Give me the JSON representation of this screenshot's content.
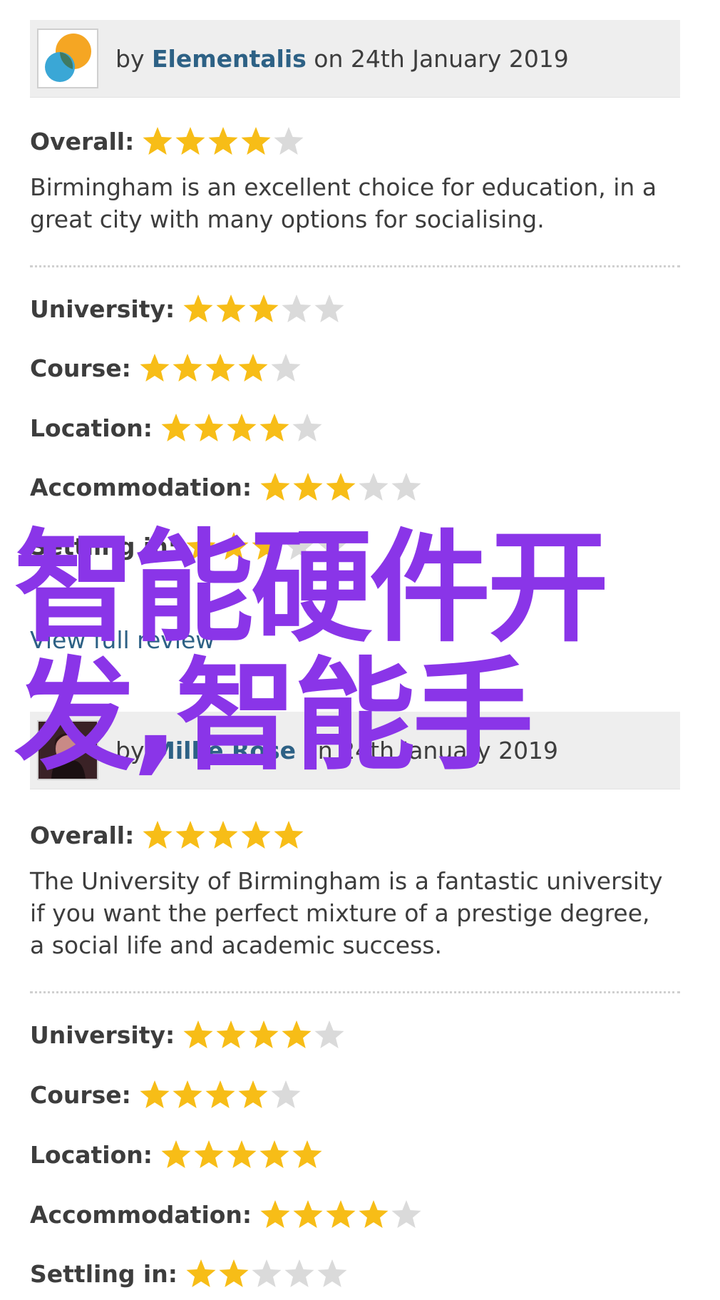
{
  "reviews": [
    {
      "by": "by",
      "author": "Elementalis",
      "on_date": "on 24th January 2019",
      "overall_label": "Overall:",
      "overall_rating": 4,
      "text": "Birmingham is an excellent choice for education, in a great city with many options for socialising.",
      "ratings": [
        {
          "label": "University:",
          "rating": 3
        },
        {
          "label": "Course:",
          "rating": 4
        },
        {
          "label": "Location:",
          "rating": 4
        },
        {
          "label": "Accommodation:",
          "rating": 3
        },
        {
          "label": "Settling in:",
          "rating": 3
        }
      ],
      "link": "View full review"
    },
    {
      "by": "by",
      "author": "Millie Rose",
      "on_date": "on 24th January 2019",
      "overall_label": "Overall:",
      "overall_rating": 5,
      "text": "The University of Birmingham is a fantastic university if you want the perfect mixture of a prestige degree, a social life and academic success.",
      "ratings": [
        {
          "label": "University:",
          "rating": 4
        },
        {
          "label": "Course:",
          "rating": 4
        },
        {
          "label": "Location:",
          "rating": 5
        },
        {
          "label": "Accommodation:",
          "rating": 4
        },
        {
          "label": "Settling in:",
          "rating": 2
        }
      ]
    }
  ],
  "watermark": {
    "line1": "智能硬件开",
    "line2": "发,智能手"
  },
  "colors": {
    "star_filled": "#f7bd17",
    "star_empty": "#dadada",
    "author_link": "#2d6185",
    "watermark": "#8a35e8"
  }
}
